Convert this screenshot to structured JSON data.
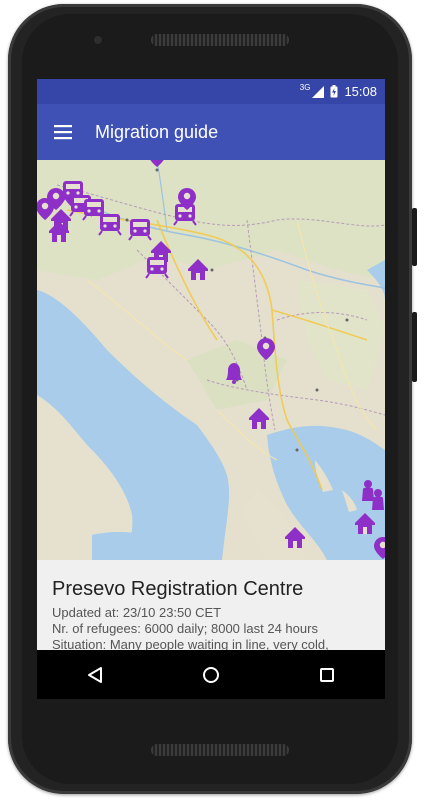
{
  "status_bar": {
    "network": "3G",
    "time": "15:08"
  },
  "app_bar": {
    "title": "Migration guide",
    "menu_icon": "hamburger-menu-icon"
  },
  "map": {
    "marker_color": "#8e2fc8",
    "marker_icons": [
      "train-icon",
      "home-icon",
      "location-pin-icon",
      "bell-icon",
      "person-icon"
    ]
  },
  "detail": {
    "place": "Presevo Registration Centre",
    "updated": "Updated at: 23/10 23:50 CET",
    "refugees": "Nr. of refugees: 6000 daily; 8000 last 24 hours",
    "situation": "Situation: Many people waiting in line, very cold,"
  },
  "nav_bar": {
    "back_icon": "back-triangle-icon",
    "home_icon": "home-circle-icon",
    "recents_icon": "recents-square-icon"
  },
  "colors": {
    "status_bar": "#3546a8",
    "app_bar": "#3f51b5",
    "sea": "#a8cce9",
    "land": "#e6e1cf"
  }
}
